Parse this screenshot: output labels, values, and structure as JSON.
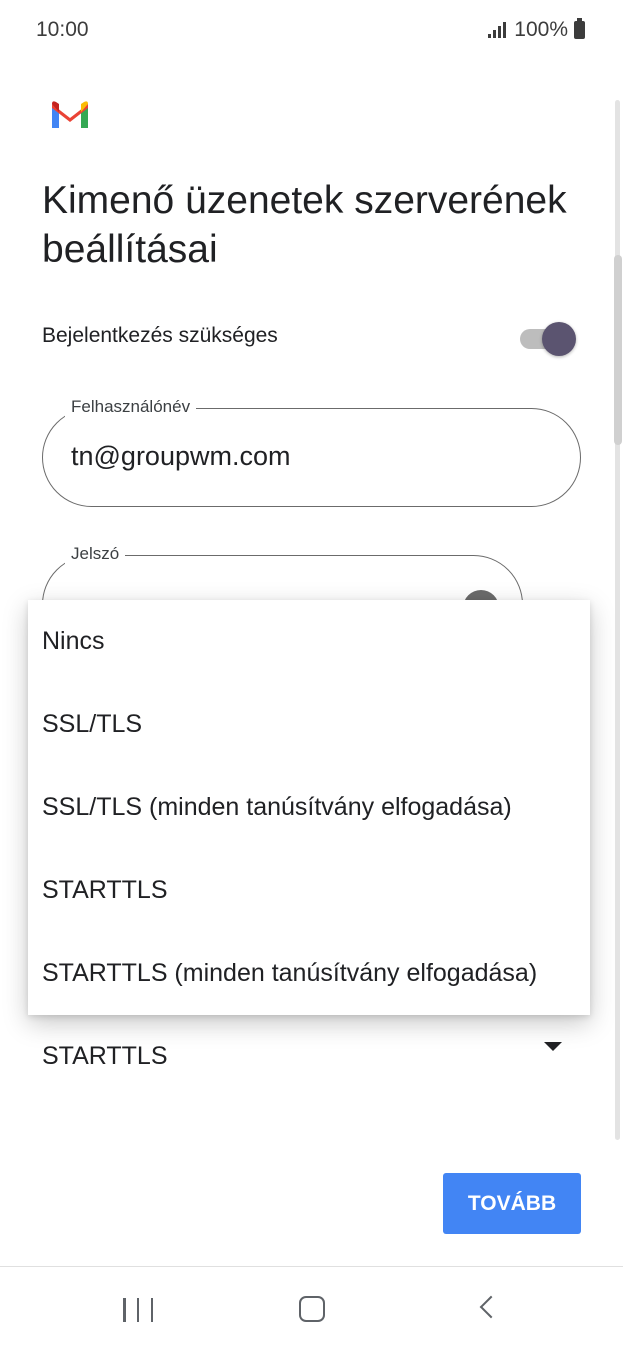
{
  "status_bar": {
    "time": "10:00",
    "battery": "100%",
    "icons": [
      "signal-icon",
      "battery-icon"
    ]
  },
  "header": {
    "logo": "gmail-logo-icon",
    "title": "Kimenő üzenetek szerverének beállításai"
  },
  "login_required": {
    "label": "Bejelentkezés szükséges",
    "enabled": true
  },
  "username": {
    "label": "Felhasználónév",
    "value": "tn@groupwm.com"
  },
  "password": {
    "label": "Jelszó",
    "icon": "eye-icon"
  },
  "security_type": {
    "selected": "STARTTLS",
    "options": [
      "Nincs",
      "SSL/TLS",
      "SSL/TLS (minden tanúsítvány elfogadása)",
      "STARTTLS",
      "STARTTLS (minden tanúsítvány elfogadása)"
    ]
  },
  "actions": {
    "next_label": "TOVÁBB"
  },
  "colors": {
    "accent": "#4285f4",
    "toggle_thumb": "#5b5470"
  },
  "nav_bar": {
    "icons": [
      "recents-icon",
      "home-icon",
      "back-icon"
    ]
  }
}
